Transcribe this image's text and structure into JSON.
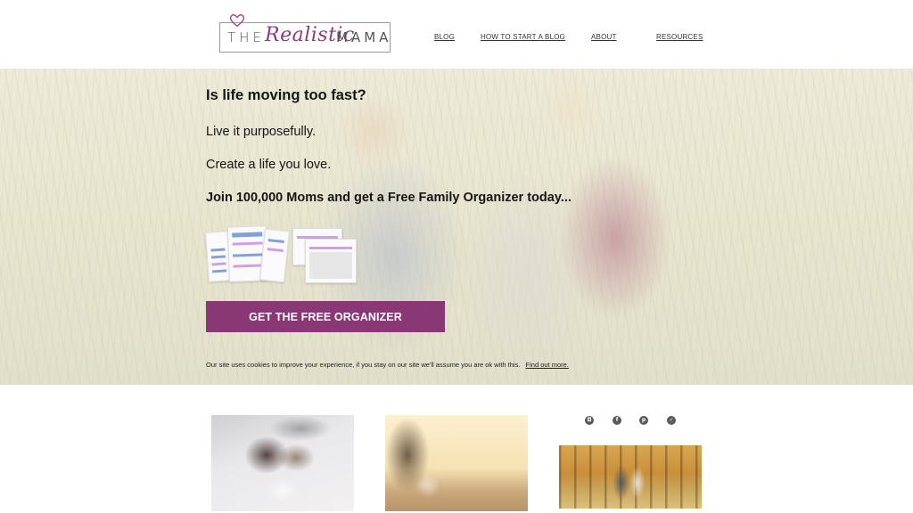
{
  "brand": {
    "logo_text_the": "THE",
    "logo_text_realistic": "Realistic",
    "logo_text_mama": "MAMA",
    "accent_color": "#8a3776"
  },
  "nav": {
    "items": [
      {
        "label": "BLOG"
      },
      {
        "label": "HOW TO START A BLOG"
      },
      {
        "label": "ABOUT"
      },
      {
        "label": "RESOURCES"
      }
    ]
  },
  "hero": {
    "title": "Is life moving too fast?",
    "line1": "Live it purposefully.",
    "line2": "Create a life you love.",
    "join": "Join 100,000 Moms and get a Free Family Organizer today...",
    "cta_label": "GET THE FREE ORGANIZER",
    "cookie_text": "Our site uses cookies to improve your experience, if you stay on our site we'll assume you are ok with this.",
    "cookie_link": "Find out more."
  },
  "social": {
    "icons": [
      {
        "name": "instagram-icon",
        "glyph": "◘"
      },
      {
        "name": "facebook-icon",
        "glyph": "f"
      },
      {
        "name": "pinterest-icon",
        "glyph": "p"
      },
      {
        "name": "twitter-icon",
        "glyph": "✓"
      }
    ]
  }
}
